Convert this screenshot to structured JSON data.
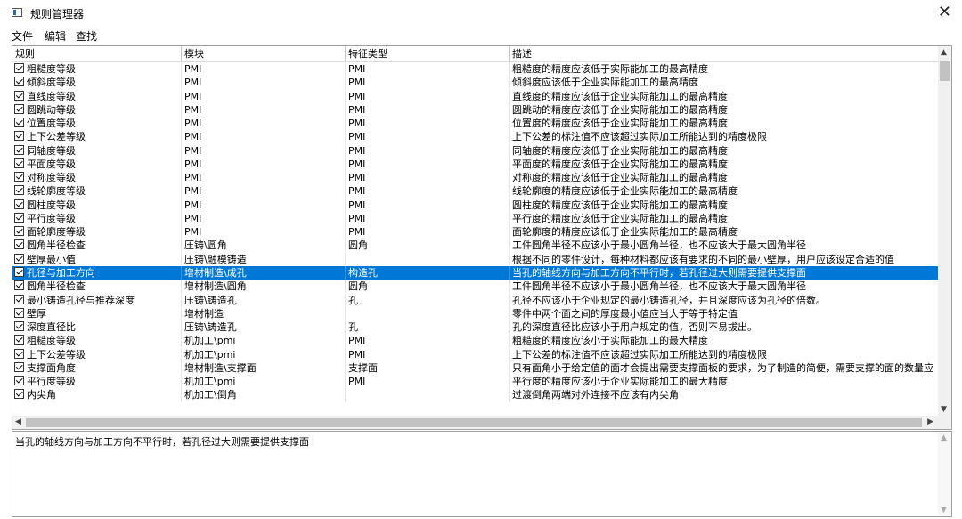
{
  "window": {
    "title": "规则管理器",
    "close_glyph": "✕"
  },
  "menu": [
    {
      "label": "文件"
    },
    {
      "label": "编辑"
    },
    {
      "label": "查找"
    }
  ],
  "table": {
    "headers": [
      "规则",
      "模块",
      "特征类型",
      "描述"
    ],
    "selected_index": 15,
    "rows": [
      {
        "rule": "粗糙度等级",
        "module": "PMI",
        "feature": "PMI",
        "description": "粗糙度的精度应该低于实际能加工的最高精度"
      },
      {
        "rule": "倾斜度等级",
        "module": "PMI",
        "feature": "PMI",
        "description": "倾斜度应该低于企业实际能加工的最高精度"
      },
      {
        "rule": "直线度等级",
        "module": "PMI",
        "feature": "PMI",
        "description": "直线度的精度应该低于企业实际能加工的最高精度"
      },
      {
        "rule": "圆跳动等级",
        "module": "PMI",
        "feature": "PMI",
        "description": "圆跳动的精度应该低于企业实际能加工的最高精度"
      },
      {
        "rule": "位置度等级",
        "module": "PMI",
        "feature": "PMI",
        "description": "位置度的精度应该低于企业实际能加工的最高精度"
      },
      {
        "rule": "上下公差等级",
        "module": "PMI",
        "feature": "PMI",
        "description": "上下公差的标注值不应该超过实际加工所能达到的精度极限"
      },
      {
        "rule": "同轴度等级",
        "module": "PMI",
        "feature": "PMI",
        "description": "同轴度的精度应该低于企业实际能加工的最高精度"
      },
      {
        "rule": "平面度等级",
        "module": "PMI",
        "feature": "PMI",
        "description": "平面度的精度应该低于企业实际能加工的最高精度"
      },
      {
        "rule": "对称度等级",
        "module": "PMI",
        "feature": "PMI",
        "description": "对称度的精度应该低于企业实际能加工的最高精度"
      },
      {
        "rule": "线轮廓度等级",
        "module": "PMI",
        "feature": "PMI",
        "description": "线轮廓度的精度应该低于企业实际能加工的最高精度"
      },
      {
        "rule": "圆柱度等级",
        "module": "PMI",
        "feature": "PMI",
        "description": "圆柱度的精度应该低于企业实际能加工的最高精度"
      },
      {
        "rule": "平行度等级",
        "module": "PMI",
        "feature": "PMI",
        "description": "平行度的精度应该低于企业实际能加工的最高精度"
      },
      {
        "rule": "面轮廓度等级",
        "module": "PMI",
        "feature": "PMI",
        "description": "面轮廓度的精度应该低于企业实际能加工的最高精度"
      },
      {
        "rule": "圆角半径检查",
        "module": "压铸\\圆角",
        "feature": "圆角",
        "description": "工件圆角半径不应该小于最小圆角半径，也不应该大于最大圆角半径"
      },
      {
        "rule": "壁厚最小值",
        "module": "压铸\\融模铸造",
        "feature": "",
        "description": "根据不同的零件设计，每种材料都应该有要求的不同的最小壁厚，用户应该设定合适的值"
      },
      {
        "rule": "孔径与加工方向",
        "module": "增材制造\\成孔",
        "feature": "构造孔",
        "description": "当孔的轴线方向与加工方向不平行时，若孔径过大则需要提供支撑面"
      },
      {
        "rule": "圆角半径检查",
        "module": "增材制造\\圆角",
        "feature": "圆角",
        "description": "工件圆角半径不应该小于最小圆角半径，也不应该大于最大圆角半径"
      },
      {
        "rule": "最小铸造孔径与推荐深度",
        "module": "压铸\\铸造孔",
        "feature": "孔",
        "description": "孔径不应该小于企业规定的最小铸造孔径，并且深度应该为孔径的倍数。"
      },
      {
        "rule": "壁厚",
        "module": "增材制造",
        "feature": "",
        "description": "零件中两个面之间的厚度最小值应当大于等于特定值"
      },
      {
        "rule": "深度直径比",
        "module": "压铸\\铸造孔",
        "feature": "孔",
        "description": "孔的深度直径比应该小于用户规定的值，否则不易拔出。"
      },
      {
        "rule": "粗糙度等级",
        "module": "机加工\\pmi",
        "feature": "PMI",
        "description": "粗糙度的精度应该小于实际能加工的最大精度"
      },
      {
        "rule": "上下公差等级",
        "module": "机加工\\pmi",
        "feature": "PMI",
        "description": "上下公差的标注值不应该超过实际加工所能达到的精度极限"
      },
      {
        "rule": "支撑面角度",
        "module": "增材制造\\支撑面",
        "feature": "支撑面",
        "description": "只有面角小于给定值的面才会提出需要支撑面板的要求，为了制造的简便，需要支撑的面的数量应"
      },
      {
        "rule": "平行度等级",
        "module": "机加工\\pmi",
        "feature": "PMI",
        "description": "平行度的精度应该小于企业实际能加工的最大精度"
      },
      {
        "rule": "内尖角",
        "module": "机加工\\倒角",
        "feature": "",
        "description": "过渡倒角两端对外连接不应该有内尖角"
      }
    ]
  },
  "detail": {
    "text": "当孔的轴线方向与加工方向不平行时，若孔径过大则需要提供支撑面"
  },
  "scrollbar_arrows": {
    "up": "▲",
    "down": "▼",
    "left": "◀",
    "right": "▶"
  },
  "colors": {
    "selection": "#0078d7",
    "selection_text": "#ffffff"
  }
}
